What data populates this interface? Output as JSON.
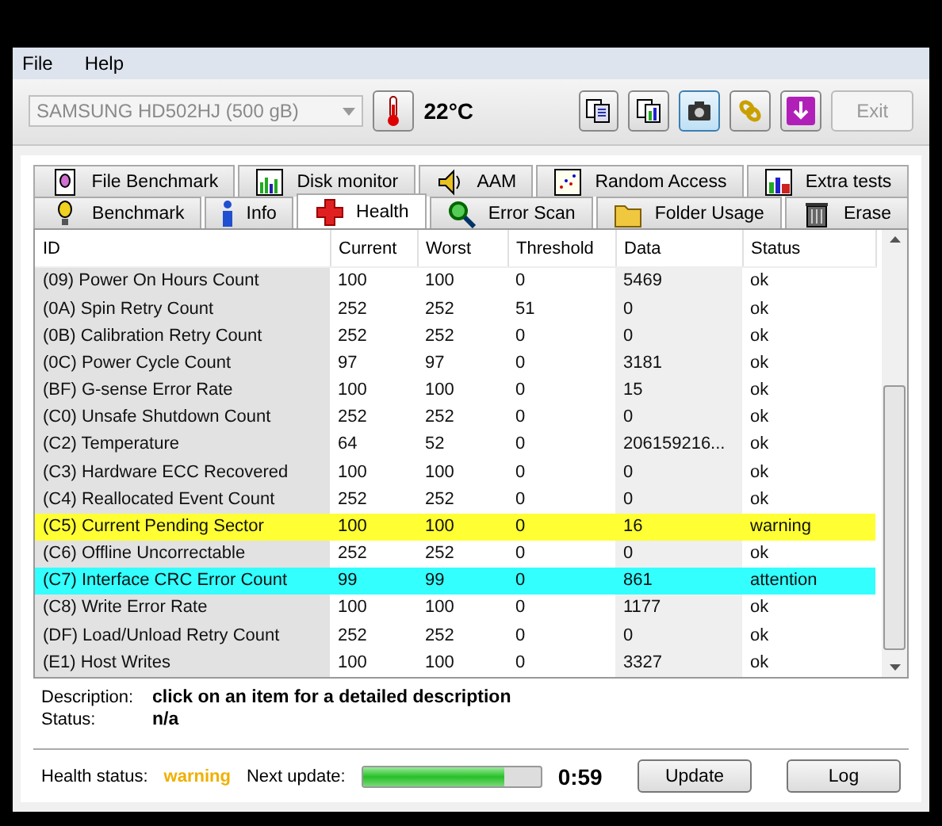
{
  "menu": [
    "File",
    "Help"
  ],
  "toolbar": {
    "drive": "SAMSUNG HD502HJ (500 gB)",
    "temperature": "22°C",
    "exit": "Exit"
  },
  "tabs_top": [
    {
      "label": "File Benchmark",
      "selected": false
    },
    {
      "label": "Disk monitor",
      "selected": false
    },
    {
      "label": "AAM",
      "selected": false
    },
    {
      "label": "Random Access",
      "selected": false
    },
    {
      "label": "Extra tests",
      "selected": false
    }
  ],
  "tabs_bottom": [
    {
      "label": "Benchmark",
      "selected": false
    },
    {
      "label": "Info",
      "selected": false
    },
    {
      "label": "Health",
      "selected": true
    },
    {
      "label": "Error Scan",
      "selected": false
    },
    {
      "label": "Folder Usage",
      "selected": false
    },
    {
      "label": "Erase",
      "selected": false
    }
  ],
  "table": {
    "columns": [
      "ID",
      "Current",
      "Worst",
      "Threshold",
      "Data",
      "Status"
    ],
    "rows": [
      {
        "cells": [
          "(09) Power On Hours Count",
          "100",
          "100",
          "0",
          "5469",
          "ok"
        ]
      },
      {
        "cells": [
          "(0A) Spin Retry Count",
          "252",
          "252",
          "51",
          "0",
          "ok"
        ]
      },
      {
        "cells": [
          "(0B) Calibration Retry Count",
          "252",
          "252",
          "0",
          "0",
          "ok"
        ]
      },
      {
        "cells": [
          "(0C) Power Cycle Count",
          "97",
          "97",
          "0",
          "3181",
          "ok"
        ]
      },
      {
        "cells": [
          "(BF) G-sense Error Rate",
          "100",
          "100",
          "0",
          "15",
          "ok"
        ]
      },
      {
        "cells": [
          "(C0) Unsafe Shutdown Count",
          "252",
          "252",
          "0",
          "0",
          "ok"
        ]
      },
      {
        "cells": [
          "(C2) Temperature",
          "64",
          "52",
          "0",
          "206159216...",
          "ok"
        ]
      },
      {
        "cells": [
          "(C3) Hardware ECC Recovered",
          "100",
          "100",
          "0",
          "0",
          "ok"
        ]
      },
      {
        "cells": [
          "(C4) Reallocated Event Count",
          "252",
          "252",
          "0",
          "0",
          "ok"
        ]
      },
      {
        "cells": [
          "(C5) Current Pending Sector",
          "100",
          "100",
          "0",
          "16",
          "warning"
        ],
        "color": "#ffff33"
      },
      {
        "cells": [
          "(C6) Offline Uncorrectable",
          "252",
          "252",
          "0",
          "0",
          "ok"
        ]
      },
      {
        "cells": [
          "(C7) Interface CRC Error Count",
          "99",
          "99",
          "0",
          "861",
          "attention"
        ],
        "color": "#33ffff"
      },
      {
        "cells": [
          "(C8) Write Error Rate",
          "100",
          "100",
          "0",
          "1177",
          "ok"
        ]
      },
      {
        "cells": [
          "(DF) Load/Unload Retry Count",
          "252",
          "252",
          "0",
          "0",
          "ok"
        ]
      },
      {
        "cells": [
          "(E1) Host Writes",
          "100",
          "100",
          "0",
          "3327",
          "ok"
        ]
      }
    ]
  },
  "details": {
    "description_label": "Description:",
    "description": "click on an item for a detailed description",
    "status_label": "Status:",
    "status": "n/a"
  },
  "footer": {
    "health_label": "Health status:",
    "health": "warning",
    "next_label": "Next update:",
    "progress": {
      "level": 0.8
    },
    "countdown": "0:59",
    "buttons": [
      "Update",
      "Log"
    ]
  }
}
